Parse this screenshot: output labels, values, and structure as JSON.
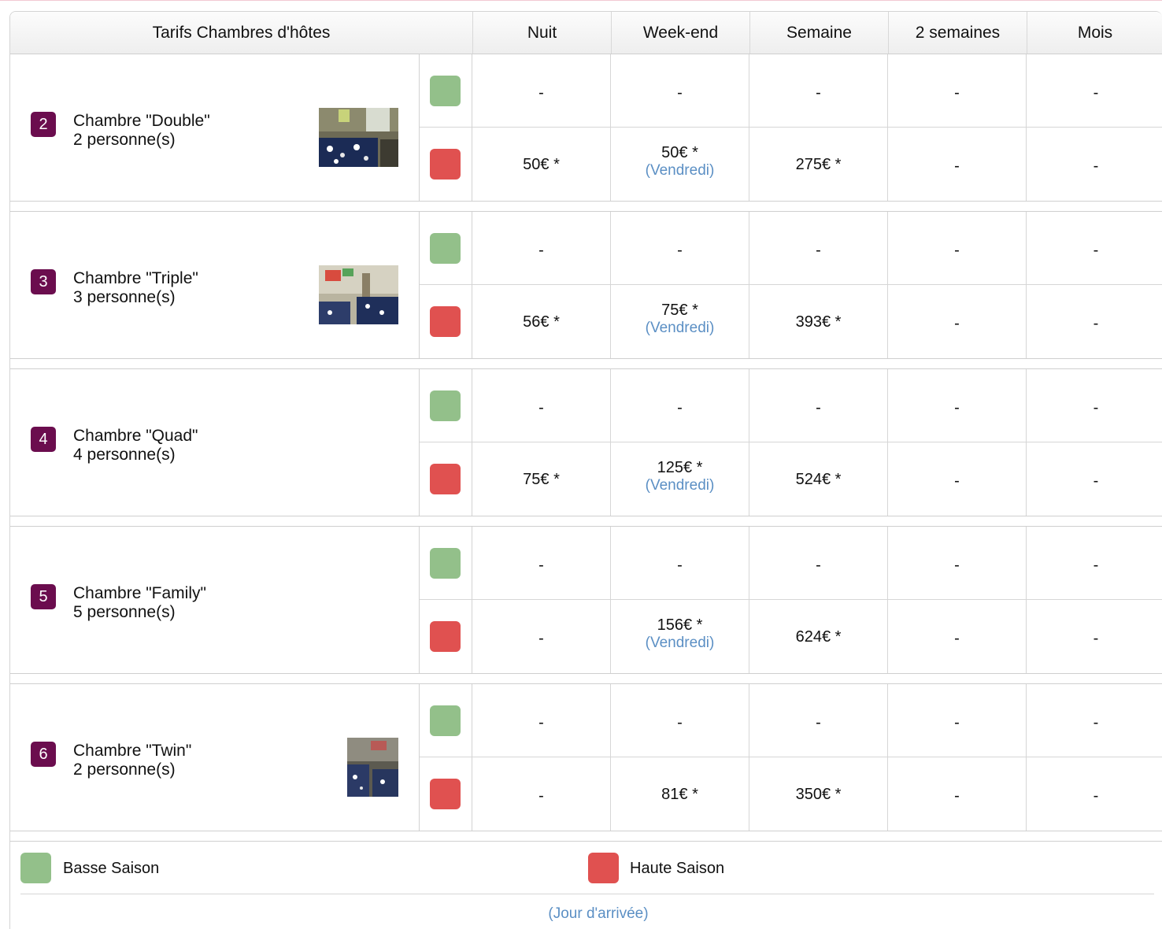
{
  "colors": {
    "low_season": "#93c08a",
    "high_season": "#e05150",
    "badge": "#6b0d4e",
    "link": "#5b8fc4"
  },
  "header": {
    "title": "Tarifs Chambres d'hôtes",
    "columns": [
      "Nuit",
      "Week-end",
      "Semaine",
      "2 semaines",
      "Mois"
    ]
  },
  "rooms": [
    {
      "number": "2",
      "name": "Chambre \"Double\"",
      "capacity": "2 personne(s)",
      "has_photo": true,
      "low": [
        "-",
        "-",
        "-",
        "-",
        "-"
      ],
      "high": [
        "50€ *",
        "50€ *",
        "275€ *",
        "-",
        "-"
      ],
      "high_weekend_note": "(Vendredi)"
    },
    {
      "number": "3",
      "name": "Chambre \"Triple\"",
      "capacity": "3 personne(s)",
      "has_photo": true,
      "low": [
        "-",
        "-",
        "-",
        "-",
        "-"
      ],
      "high": [
        "56€ *",
        "75€ *",
        "393€ *",
        "-",
        "-"
      ],
      "high_weekend_note": "(Vendredi)"
    },
    {
      "number": "4",
      "name": "Chambre \"Quad\"",
      "capacity": "4 personne(s)",
      "has_photo": false,
      "low": [
        "-",
        "-",
        "-",
        "-",
        "-"
      ],
      "high": [
        "75€ *",
        "125€ *",
        "524€ *",
        "-",
        "-"
      ],
      "high_weekend_note": "(Vendredi)"
    },
    {
      "number": "5",
      "name": "Chambre \"Family\"",
      "capacity": "5 personne(s)",
      "has_photo": false,
      "low": [
        "-",
        "-",
        "-",
        "-",
        "-"
      ],
      "high": [
        "-",
        "156€ *",
        "624€ *",
        "-",
        "-"
      ],
      "high_weekend_note": "(Vendredi)"
    },
    {
      "number": "6",
      "name": "Chambre \"Twin\"",
      "capacity": "2 personne(s)",
      "has_photo": true,
      "low": [
        "-",
        "-",
        "-",
        "-",
        "-"
      ],
      "high": [
        "-",
        "81€ *",
        "350€ *",
        "-",
        "-"
      ],
      "high_weekend_note": ""
    }
  ],
  "legend": {
    "low_label": "Basse Saison",
    "high_label": "Haute Saison",
    "footnote": "(Jour d'arrivée)"
  }
}
